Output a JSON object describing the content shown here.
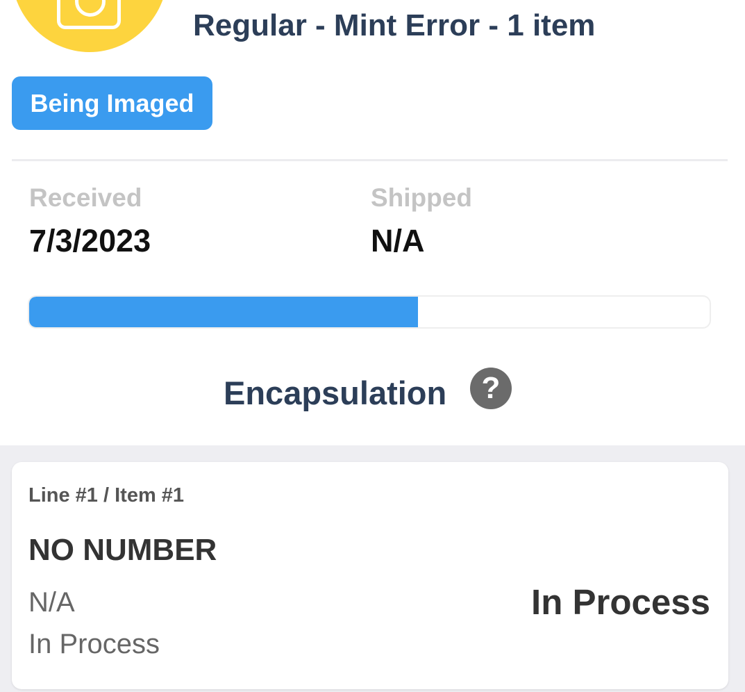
{
  "order": {
    "title": "Regular - Mint Error - 1 item",
    "status_badge": "Being Imaged"
  },
  "dates": {
    "received_label": "Received",
    "received_value": "7/3/2023",
    "shipped_label": "Shipped",
    "shipped_value": "N/A"
  },
  "progress": {
    "fraction": 0.571
  },
  "stage": {
    "title": "Encapsulation",
    "help_glyph": "?"
  },
  "items": [
    {
      "line_label": "Line #1 / Item #1",
      "name": "NO NUMBER",
      "detail_1": "N/A",
      "detail_2": "In Process",
      "status": "In Process"
    }
  ],
  "colors": {
    "accent": "#3a9bef",
    "avatar": "#fdd43e",
    "title": "#2c3e58"
  },
  "icons": {
    "avatar": "camera-icon",
    "help": "question-circle-icon"
  }
}
